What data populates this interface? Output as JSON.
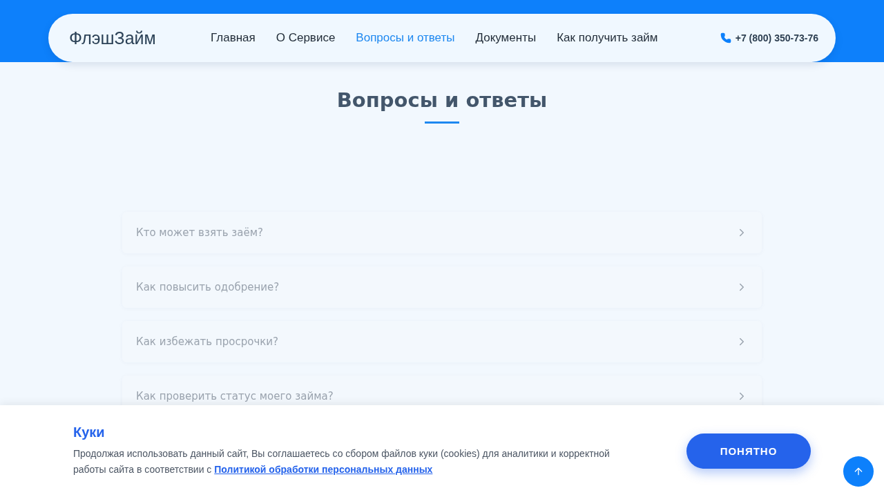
{
  "header": {
    "logo": "ФлэшЗайм",
    "nav": [
      {
        "label": "Главная",
        "selected": false
      },
      {
        "label": "О Сервисе",
        "selected": false
      },
      {
        "label": "Вопросы и ответы",
        "selected": true
      },
      {
        "label": "Документы",
        "selected": false
      },
      {
        "label": "Как получить займ",
        "selected": false
      }
    ],
    "phone": "+7 (800) 350-73-76"
  },
  "page_title": "Вопросы и ответы",
  "faq": [
    {
      "question": "Кто может взять заём?",
      "expanded": false
    },
    {
      "question": "Как повысить одобрение?",
      "expanded": false
    },
    {
      "question": "Как избежать просрочки?",
      "expanded": false
    },
    {
      "question": "Как проверить статус моего займа?",
      "expanded": false
    }
  ],
  "cookie_banner": {
    "title": "Куки",
    "text": "Продолжая использовать данный сайт, Вы соглашаетесь со сбором файлов куки (cookies) для аналитики и корректной работы сайта в соответствии с",
    "link": "Политикой обработки персональных данных",
    "button": "ПОНЯТНО"
  }
}
